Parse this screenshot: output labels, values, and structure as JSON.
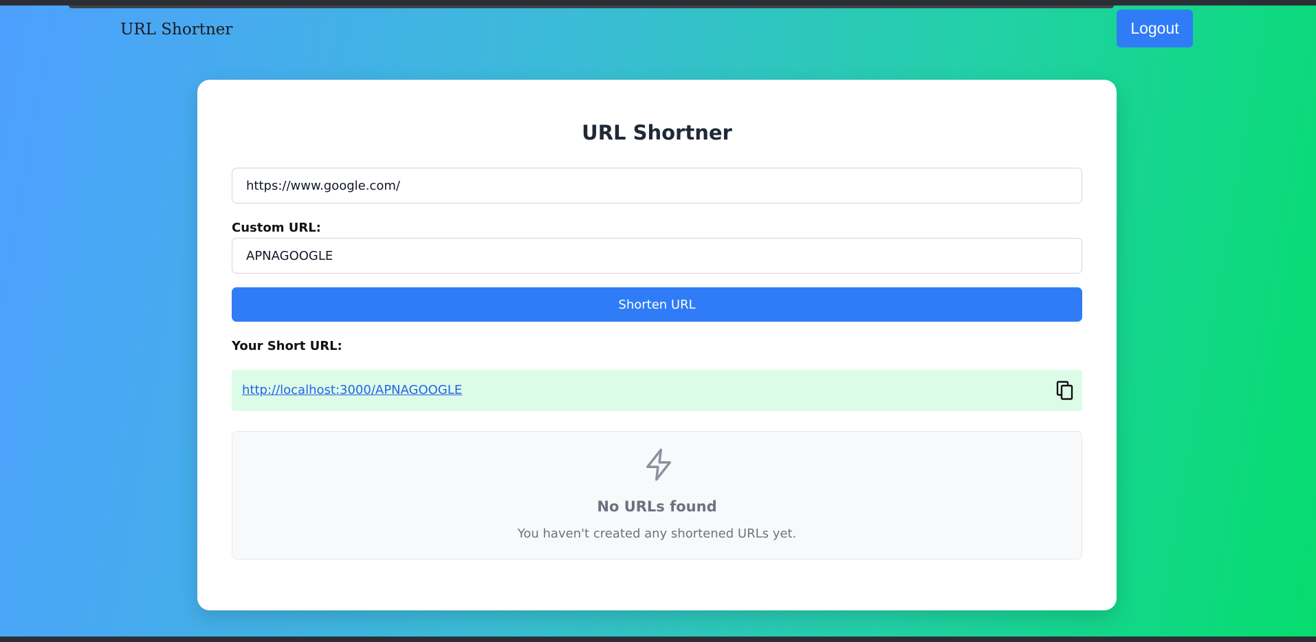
{
  "navbar": {
    "brand": "URL Shortner",
    "logout_label": "Logout"
  },
  "card": {
    "title": "URL Shortner",
    "url_input_value": "https://www.google.com/",
    "custom_label": "Custom URL:",
    "custom_input_value": "APNAGOOGLE",
    "shorten_label": "Shorten URL",
    "short_url_label": "Your Short URL:",
    "short_url": "http://localhost:3000/APNAGOOGLE",
    "copy_icon": "copy-icon"
  },
  "empty_state": {
    "icon": "lightning-bolt-icon",
    "title": "No URLs found",
    "subtitle": "You haven't created any shortened URLs yet."
  },
  "colors": {
    "primary": "#2f7cf6",
    "success_bg": "#dcfce7",
    "link": "#2563eb",
    "gradient_start": "#4ea0ff",
    "gradient_end": "#05dc6e"
  }
}
